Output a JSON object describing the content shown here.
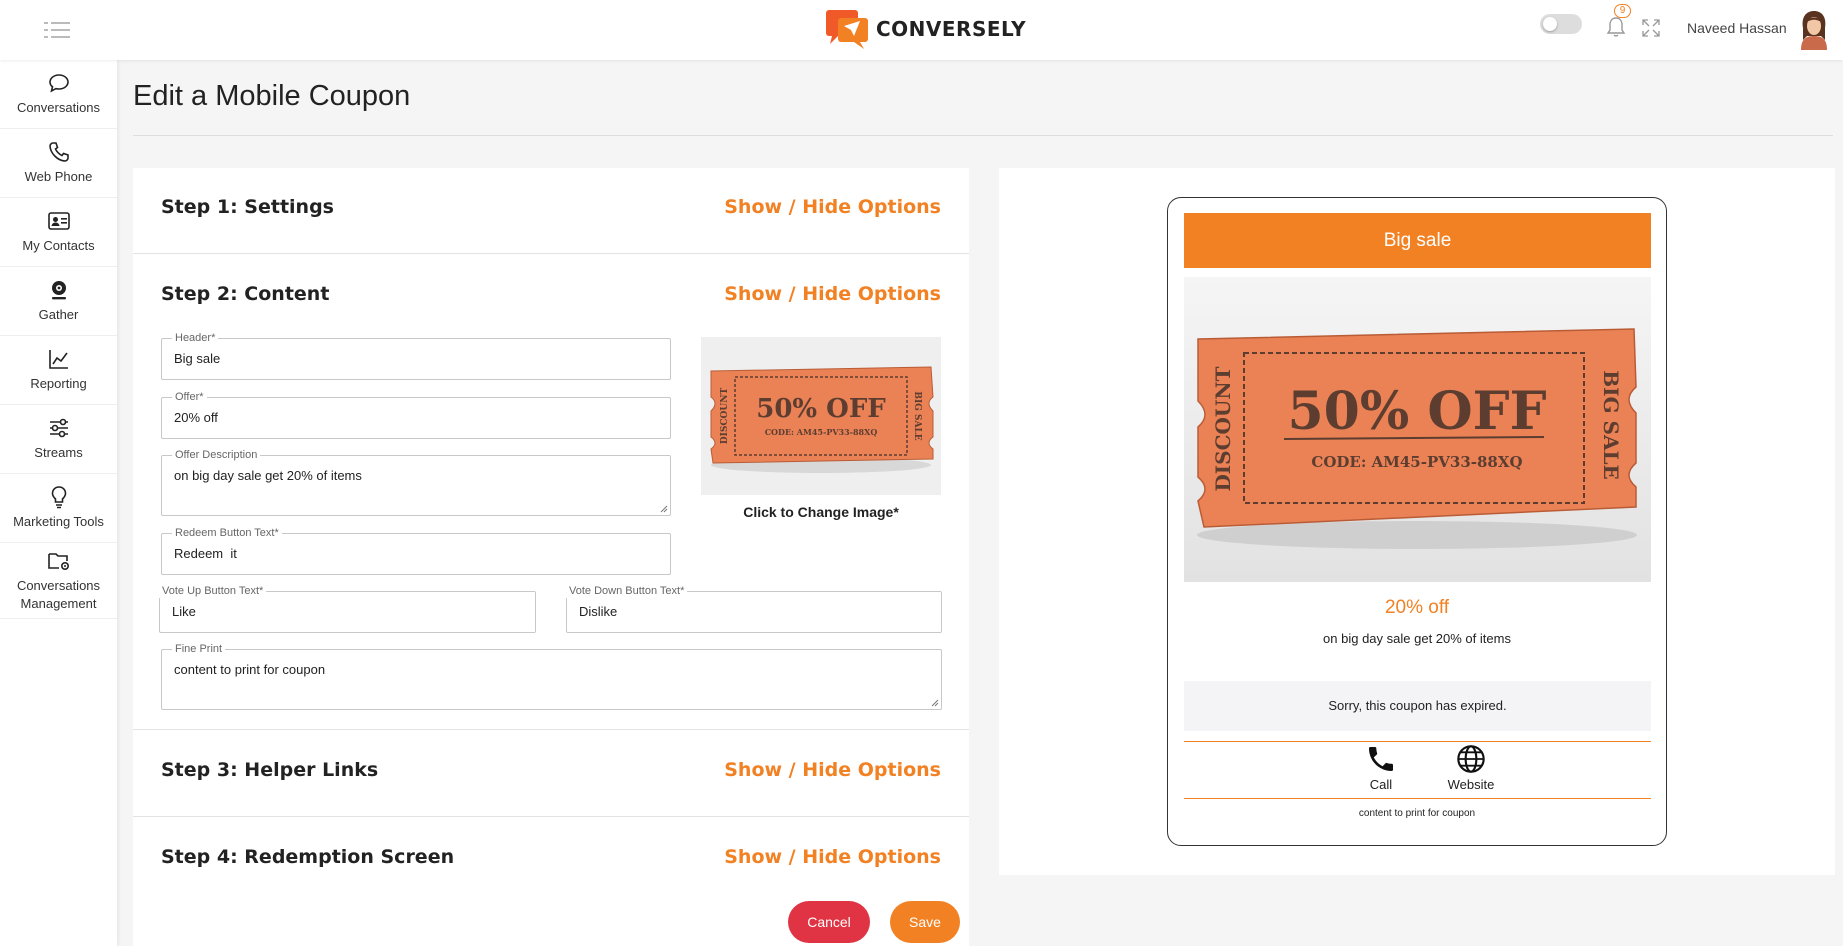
{
  "app": {
    "brand": "CONVERSELY",
    "notifications_count": "9",
    "user_name": "Naveed Hassan",
    "accent_color": "#f28123",
    "danger_color": "#e03444"
  },
  "sidebar": {
    "items": [
      {
        "label": "Conversations",
        "icon": "chat-bubble-icon"
      },
      {
        "label": "Web Phone",
        "icon": "phone-icon"
      },
      {
        "label": "My Contacts",
        "icon": "contact-card-icon"
      },
      {
        "label": "Gather",
        "icon": "webcam-icon"
      },
      {
        "label": "Reporting",
        "icon": "line-chart-icon"
      },
      {
        "label": "Streams",
        "icon": "sliders-icon"
      },
      {
        "label": "Marketing Tools",
        "icon": "lightbulb-icon"
      },
      {
        "label": "Conversations Management",
        "icon": "folder-gear-icon"
      }
    ]
  },
  "page": {
    "title": "Edit a Mobile Coupon"
  },
  "steps": [
    {
      "title": "Step 1: Settings",
      "toggle": "Show / Hide Options"
    },
    {
      "title": "Step 2: Content",
      "toggle": "Show / Hide Options"
    },
    {
      "title": "Step 3: Helper Links",
      "toggle": "Show / Hide Options"
    },
    {
      "title": "Step 4: Redemption Screen",
      "toggle": "Show / Hide Options"
    }
  ],
  "form": {
    "header": {
      "label": "Header*",
      "value": "Big sale"
    },
    "offer": {
      "label": "Offer*",
      "value": "20% off"
    },
    "offer_description": {
      "label": "Offer Description",
      "value": "on big day sale get 20% of items"
    },
    "redeem_button": {
      "label": "Redeem Button Text*",
      "value": "Redeem  it"
    },
    "vote_up": {
      "label": "Vote Up Button Text*",
      "value": "Like"
    },
    "vote_down": {
      "label": "Vote Down Button Text*",
      "value": "Dislike"
    },
    "fine_print": {
      "label": "Fine Print",
      "value": "content to print for coupon"
    },
    "change_image": "Click to Change Image*",
    "coupon_image": {
      "headline": "50% OFF",
      "code": "CODE: AM45-PV33-88XQ",
      "left_side": "DISCOUNT",
      "right_side": "BIG SALE"
    }
  },
  "actions": {
    "cancel": "Cancel",
    "save": "Save"
  },
  "preview": {
    "header": "Big sale",
    "offer": "20% off",
    "description": "on big day sale get 20% of items",
    "expired_message": "Sorry, this coupon has expired.",
    "links": [
      {
        "label": "Call",
        "icon": "phone-icon"
      },
      {
        "label": "Website",
        "icon": "globe-icon"
      }
    ],
    "fine_print": "content to print for coupon"
  }
}
